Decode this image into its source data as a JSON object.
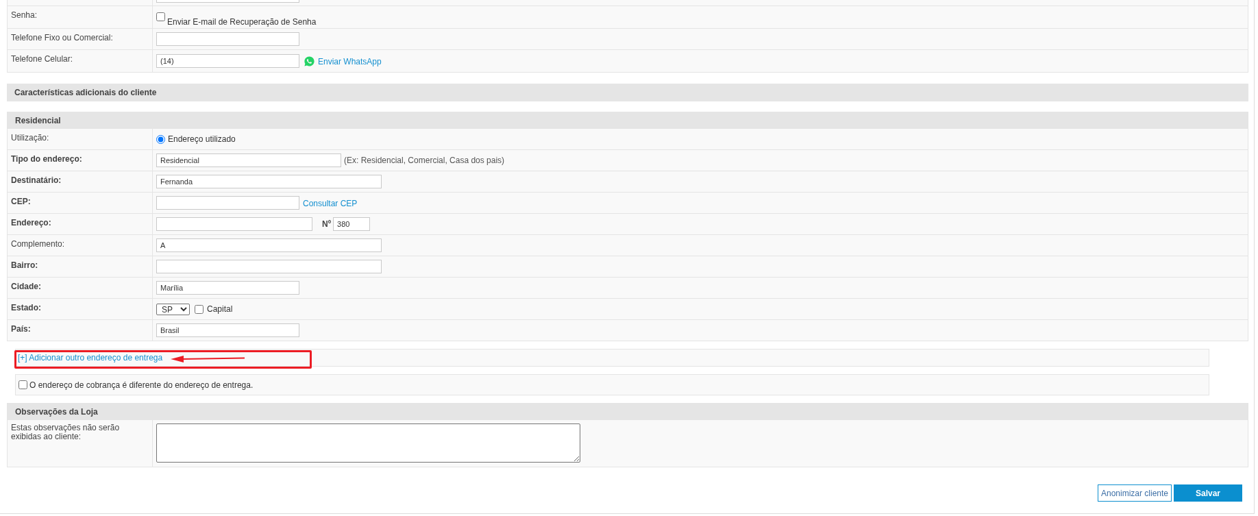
{
  "contact": {
    "rows": [
      {
        "label": "Senha:",
        "bold": false,
        "kind": "checkbox",
        "option": {
          "label": "Enviar E-mail de Recuperação de Senha",
          "checked": false
        }
      },
      {
        "label": "Telefone Fixo ou Comercial:",
        "bold": false,
        "kind": "input"
      },
      {
        "label": "Telefone Celular:",
        "bold": false,
        "kind": "phone",
        "value": "(14)",
        "link": "Enviar WhatsApp"
      }
    ]
  },
  "additional_header": "Características adicionais do cliente",
  "address": {
    "title": "Residencial",
    "rows": [
      {
        "label": "Utilização:",
        "bold": false,
        "kind": "radio",
        "option": {
          "label": "Endereço utilizado",
          "selected": true
        }
      },
      {
        "label": "Tipo do endereço:",
        "bold": true,
        "kind": "hint",
        "value": "Residencial",
        "hint": "(Ex: Residencial, Comercial, Casa dos pais)"
      },
      {
        "label": "Destinatário:",
        "bold": true,
        "kind": "long",
        "value": "Fernanda"
      },
      {
        "label": "CEP:",
        "bold": true,
        "kind": "link",
        "link": "Consultar CEP"
      },
      {
        "label": "Endereço:",
        "bold": true,
        "kind": "street",
        "number_label": "Nº",
        "number": "380"
      },
      {
        "label": "Complemento:",
        "bold": false,
        "kind": "long",
        "value": "A"
      },
      {
        "label": "Bairro:",
        "bold": true,
        "kind": "long"
      },
      {
        "label": "Cidade:",
        "bold": true,
        "kind": "short",
        "value": "Marília"
      },
      {
        "label": "Estado:",
        "bold": true,
        "kind": "state",
        "value": "SP",
        "option": {
          "label": "Capital",
          "checked": false
        }
      },
      {
        "label": "País:",
        "bold": true,
        "kind": "short",
        "value": "Brasil"
      }
    ]
  },
  "add_address_link": "[+] Adicionar outro endereço de entrega",
  "billing_option": {
    "label": "O endereço de cobrança é diferente do endereço de entrega.",
    "checked": false
  },
  "notes": {
    "title": "Observações da Loja",
    "label": "Estas observações não serão exibidas ao cliente:"
  },
  "buttons": [
    {
      "label": "Anonimizar cliente",
      "kind": "outline"
    },
    {
      "label": "Salvar",
      "kind": "primary"
    }
  ]
}
